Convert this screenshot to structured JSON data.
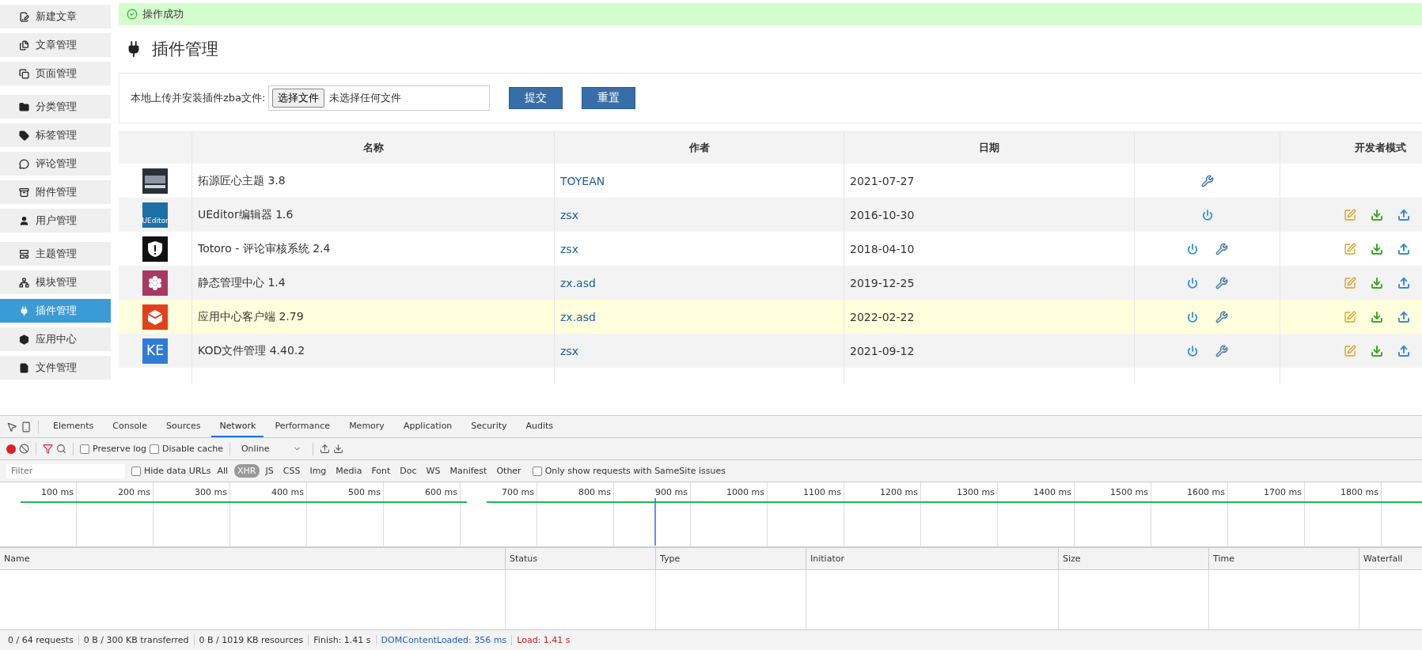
{
  "sidebar": {
    "groups": [
      {
        "items": [
          {
            "label": "新建文章",
            "selected": false
          },
          {
            "label": "文章管理",
            "selected": false
          },
          {
            "label": "页面管理",
            "selected": false
          }
        ]
      },
      {
        "items": [
          {
            "label": "分类管理",
            "selected": false
          },
          {
            "label": "标签管理",
            "selected": false
          },
          {
            "label": "评论管理",
            "selected": false
          },
          {
            "label": "附件管理",
            "selected": false
          },
          {
            "label": "用户管理",
            "selected": false
          }
        ]
      },
      {
        "items": [
          {
            "label": "主题管理",
            "selected": false
          },
          {
            "label": "模块管理",
            "selected": false
          },
          {
            "label": "插件管理",
            "selected": true
          },
          {
            "label": "应用中心",
            "selected": false
          },
          {
            "label": "文件管理",
            "selected": false
          }
        ]
      }
    ]
  },
  "alert": {
    "text": "操作成功"
  },
  "page_title": "插件管理",
  "upload": {
    "label": "本地上传并安装插件zba文件:",
    "choose_button": "选择文件",
    "file_status": "未选择任何文件",
    "submit": "提交",
    "reset": "重置"
  },
  "table": {
    "columns": [
      "名称",
      "作者",
      "日期",
      "开发者模式"
    ],
    "rows": [
      {
        "kind": "thumb",
        "color": "#2b2f36",
        "name": "拓源匠心主题 3.8",
        "author": "TOYEAN",
        "date": "2021-07-27",
        "power": false,
        "settings": true,
        "dev_tools": false,
        "highlighted": false
      },
      {
        "kind": "ueditor",
        "color": "#1e6ea8",
        "logo_text": "UEditor",
        "name": "UEditor编辑器 1.6",
        "author": "zsx",
        "date": "2016-10-30",
        "power": true,
        "settings": false,
        "dev_tools": true,
        "highlighted": false
      },
      {
        "kind": "shield",
        "color": "#111111",
        "name": "Totoro - 评论审核系统 2.4",
        "author": "zsx",
        "date": "2018-04-10",
        "power": true,
        "settings": true,
        "dev_tools": true,
        "highlighted": false
      },
      {
        "kind": "flower",
        "color": "#a83a62",
        "name": "静态管理中心 1.4",
        "author": "zx.asd",
        "date": "2019-12-25",
        "power": true,
        "settings": true,
        "dev_tools": true,
        "highlighted": false
      },
      {
        "kind": "cube",
        "color": "#e2401c",
        "name": "应用中心客户端 2.79",
        "author": "zx.asd",
        "date": "2022-02-22",
        "power": true,
        "settings": true,
        "dev_tools": true,
        "highlighted": true
      },
      {
        "kind": "text",
        "color": "#2f7bd8",
        "logo_text": "KE",
        "name": "KOD文件管理 4.40.2",
        "author": "zsx",
        "date": "2021-09-12",
        "power": true,
        "settings": true,
        "dev_tools": true,
        "highlighted": false
      }
    ]
  },
  "devtools": {
    "tabs": [
      {
        "label": "Elements",
        "selected": false
      },
      {
        "label": "Console",
        "selected": false
      },
      {
        "label": "Sources",
        "selected": false
      },
      {
        "label": "Network",
        "selected": true
      },
      {
        "label": "Performance",
        "selected": false
      },
      {
        "label": "Memory",
        "selected": false
      },
      {
        "label": "Application",
        "selected": false
      },
      {
        "label": "Security",
        "selected": false
      },
      {
        "label": "Audits",
        "selected": false
      }
    ],
    "preserve_log": {
      "label": "Preserve log",
      "checked": false
    },
    "disable_cache": {
      "label": "Disable cache",
      "checked": false
    },
    "throttle": "Online",
    "filter": {
      "placeholder": "Filter"
    },
    "hide_data_urls": {
      "label": "Hide data URLs",
      "checked": false
    },
    "types": [
      {
        "label": "All",
        "selected": false
      },
      {
        "label": "XHR",
        "selected": true
      },
      {
        "label": "JS",
        "selected": false
      },
      {
        "label": "CSS",
        "selected": false
      },
      {
        "label": "Img",
        "selected": false
      },
      {
        "label": "Media",
        "selected": false
      },
      {
        "label": "Font",
        "selected": false
      },
      {
        "label": "Doc",
        "selected": false
      },
      {
        "label": "WS",
        "selected": false
      },
      {
        "label": "Manifest",
        "selected": false
      },
      {
        "label": "Other",
        "selected": false
      }
    ],
    "samesite": {
      "label": "Only show requests with SameSite issues",
      "checked": false
    },
    "ticks": [
      "100 ms",
      "200 ms",
      "300 ms",
      "400 ms",
      "500 ms",
      "600 ms",
      "700 ms",
      "800 ms",
      "900 ms",
      "1000 ms",
      "1100 ms",
      "1200 ms",
      "1300 ms",
      "1400 ms",
      "1500 ms",
      "1600 ms",
      "1700 ms",
      "1800 ms"
    ],
    "columns": [
      "Name",
      "Status",
      "Type",
      "Initiator",
      "Size",
      "Time",
      "Waterfall"
    ],
    "status": [
      {
        "text": "0 / 64 requests",
        "kind": "plain"
      },
      {
        "text": "0 B / 300 KB transferred",
        "kind": "plain"
      },
      {
        "text": "0 B / 1019 KB resources",
        "kind": "plain"
      },
      {
        "text": "Finish: 1.41 s",
        "kind": "plain"
      },
      {
        "text": "DOMContentLoaded: 356 ms",
        "kind": "dom"
      },
      {
        "text": "Load: 1.41 s",
        "kind": "load"
      }
    ]
  }
}
